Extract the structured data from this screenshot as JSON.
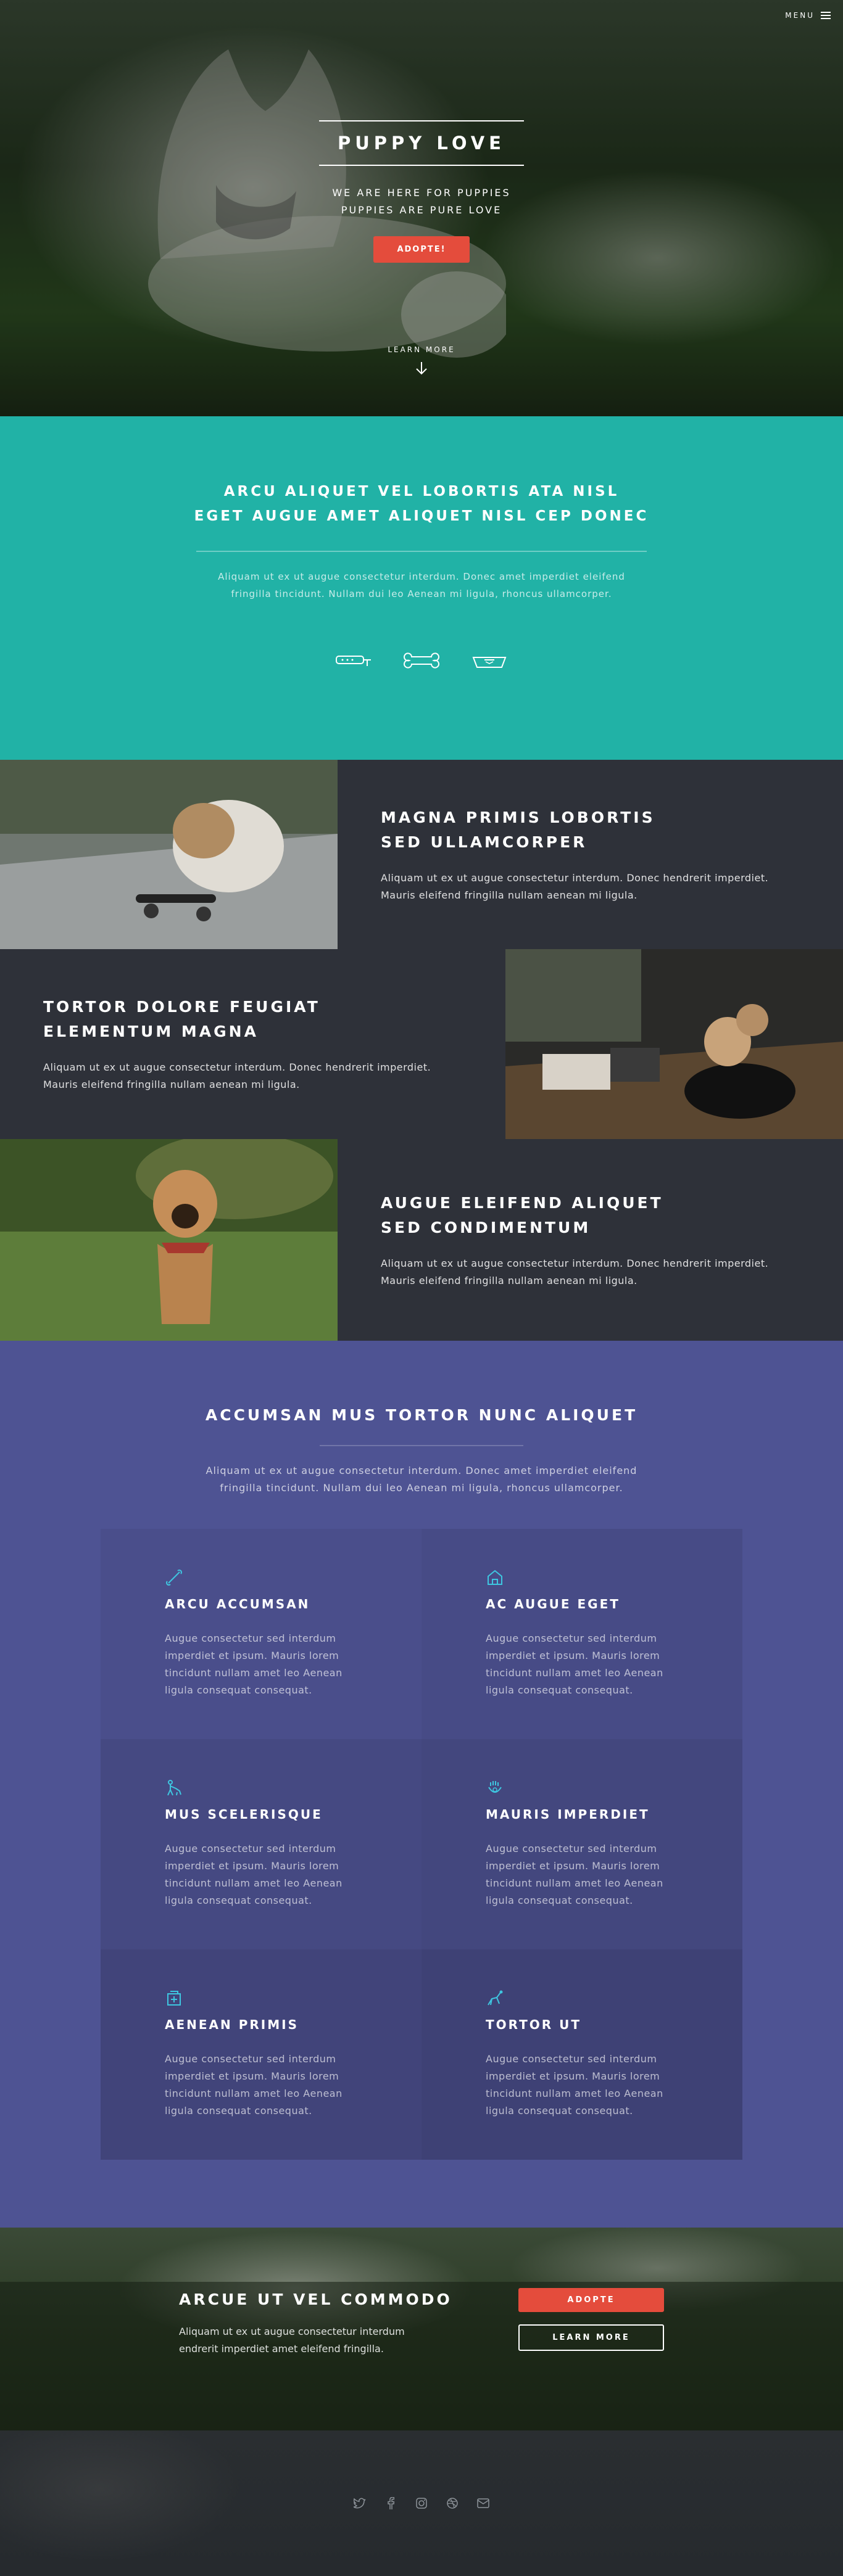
{
  "nav": {
    "menu_label": "MENU"
  },
  "hero": {
    "title": "PUPPY LOVE",
    "subtitle_line1": "WE ARE HERE FOR PUPPIES",
    "subtitle_line2": "PUPPIES ARE PURE LOVE",
    "cta_label": "ADOPTE!",
    "learn_more_label": "LEARN MORE"
  },
  "intro": {
    "heading_line1": "ARCU ALIQUET VEL LOBORTIS ATA NISL",
    "heading_line2": "EGET AUGUE AMET ALIQUET NISL CEP DONEC",
    "body_line1": "Aliquam ut ex ut augue consectetur interdum. Donec amet imperdiet eleifend",
    "body_line2": "fringilla tincidunt. Nullam dui leo Aenean mi ligula, rhoncus ullamcorper.",
    "icons": [
      "collar-icon",
      "bone-icon",
      "food-bowl-icon"
    ]
  },
  "spotlights": [
    {
      "heading_line1": "MAGNA PRIMIS LOBORTIS",
      "heading_line2": "SED ULLAMCORPER",
      "body_line1": "Aliquam ut ex ut augue consectetur interdum. Donec hendrerit imperdiet.",
      "body_line2": "Mauris eleifend fringilla nullam aenean mi ligula."
    },
    {
      "heading_line1": "TORTOR DOLORE FEUGIAT",
      "heading_line2": "ELEMENTUM MAGNA",
      "body_line1": "Aliquam ut ex ut augue consectetur interdum. Donec hendrerit imperdiet.",
      "body_line2": "Mauris eleifend fringilla nullam aenean mi ligula."
    },
    {
      "heading_line1": "AUGUE ELEIFEND ALIQUET",
      "heading_line2": "SED CONDIMENTUM",
      "body_line1": "Aliquam ut ex ut augue consectetur interdum. Donec hendrerit imperdiet.",
      "body_line2": "Mauris eleifend fringilla nullam aenean mi ligula."
    }
  ],
  "features_section": {
    "heading": "ACCUMSAN MUS TORTOR NUNC ALIQUET",
    "lead_line1": "Aliquam ut ex ut augue consectetur interdum. Donec amet imperdiet eleifend",
    "lead_line2": "fringilla tincidunt. Nullam dui leo Aenean mi ligula, rhoncus ullamcorper.",
    "items": [
      {
        "title": "ARCU ACCUMSAN",
        "icon": "bone-icon",
        "l1": "Augue consectetur sed interdum",
        "l2": "imperdiet et ipsum. Mauris lorem",
        "l3": "tincidunt nullam amet leo Aenean",
        "l4": "ligula consequat consequat."
      },
      {
        "title": "AC AUGUE EGET",
        "icon": "dog-house-icon",
        "l1": "Augue consectetur sed interdum",
        "l2": "imperdiet et ipsum. Mauris lorem",
        "l3": "tincidunt nullam amet leo Aenean",
        "l4": "ligula consequat consequat."
      },
      {
        "title": "MUS SCELERISQUE",
        "icon": "dog-walk-icon",
        "l1": "Augue consectetur sed interdum",
        "l2": "imperdiet et ipsum. Mauris lorem",
        "l3": "tincidunt nullam amet leo Aenean",
        "l4": "ligula consequat consequat."
      },
      {
        "title": "MAURIS IMPERDIET",
        "icon": "paw-hand-icon",
        "l1": "Augue consectetur sed interdum",
        "l2": "imperdiet et ipsum. Mauris lorem",
        "l3": "tincidunt nullam amet leo Aenean",
        "l4": "ligula consequat consequat."
      },
      {
        "title": "AENEAN PRIMIS",
        "icon": "vet-clinic-icon",
        "l1": "Augue consectetur sed interdum",
        "l2": "imperdiet et ipsum. Mauris lorem",
        "l3": "tincidunt nullam amet leo Aenean",
        "l4": "ligula consequat consequat."
      },
      {
        "title": "TORTOR UT",
        "icon": "dog-jump-icon",
        "l1": "Augue consectetur sed interdum",
        "l2": "imperdiet et ipsum. Mauris lorem",
        "l3": "tincidunt nullam amet leo Aenean",
        "l4": "ligula consequat consequat."
      }
    ]
  },
  "cta": {
    "heading": "ARCUE UT VEL COMMODO",
    "body_line1": "Aliquam ut ex ut augue consectetur interdum",
    "body_line2": "endrerit imperdiet amet eleifend fringilla.",
    "primary_label": "ADOPTE",
    "secondary_label": "LEARN MORE"
  },
  "footer": {
    "social": [
      "twitter-icon",
      "facebook-icon",
      "instagram-icon",
      "dribbble-icon",
      "email-icon"
    ]
  },
  "colors": {
    "teal": "#21b2a6",
    "purple": "#4e5393",
    "accent_red": "#e44c3c",
    "dark": "#2e3139"
  }
}
